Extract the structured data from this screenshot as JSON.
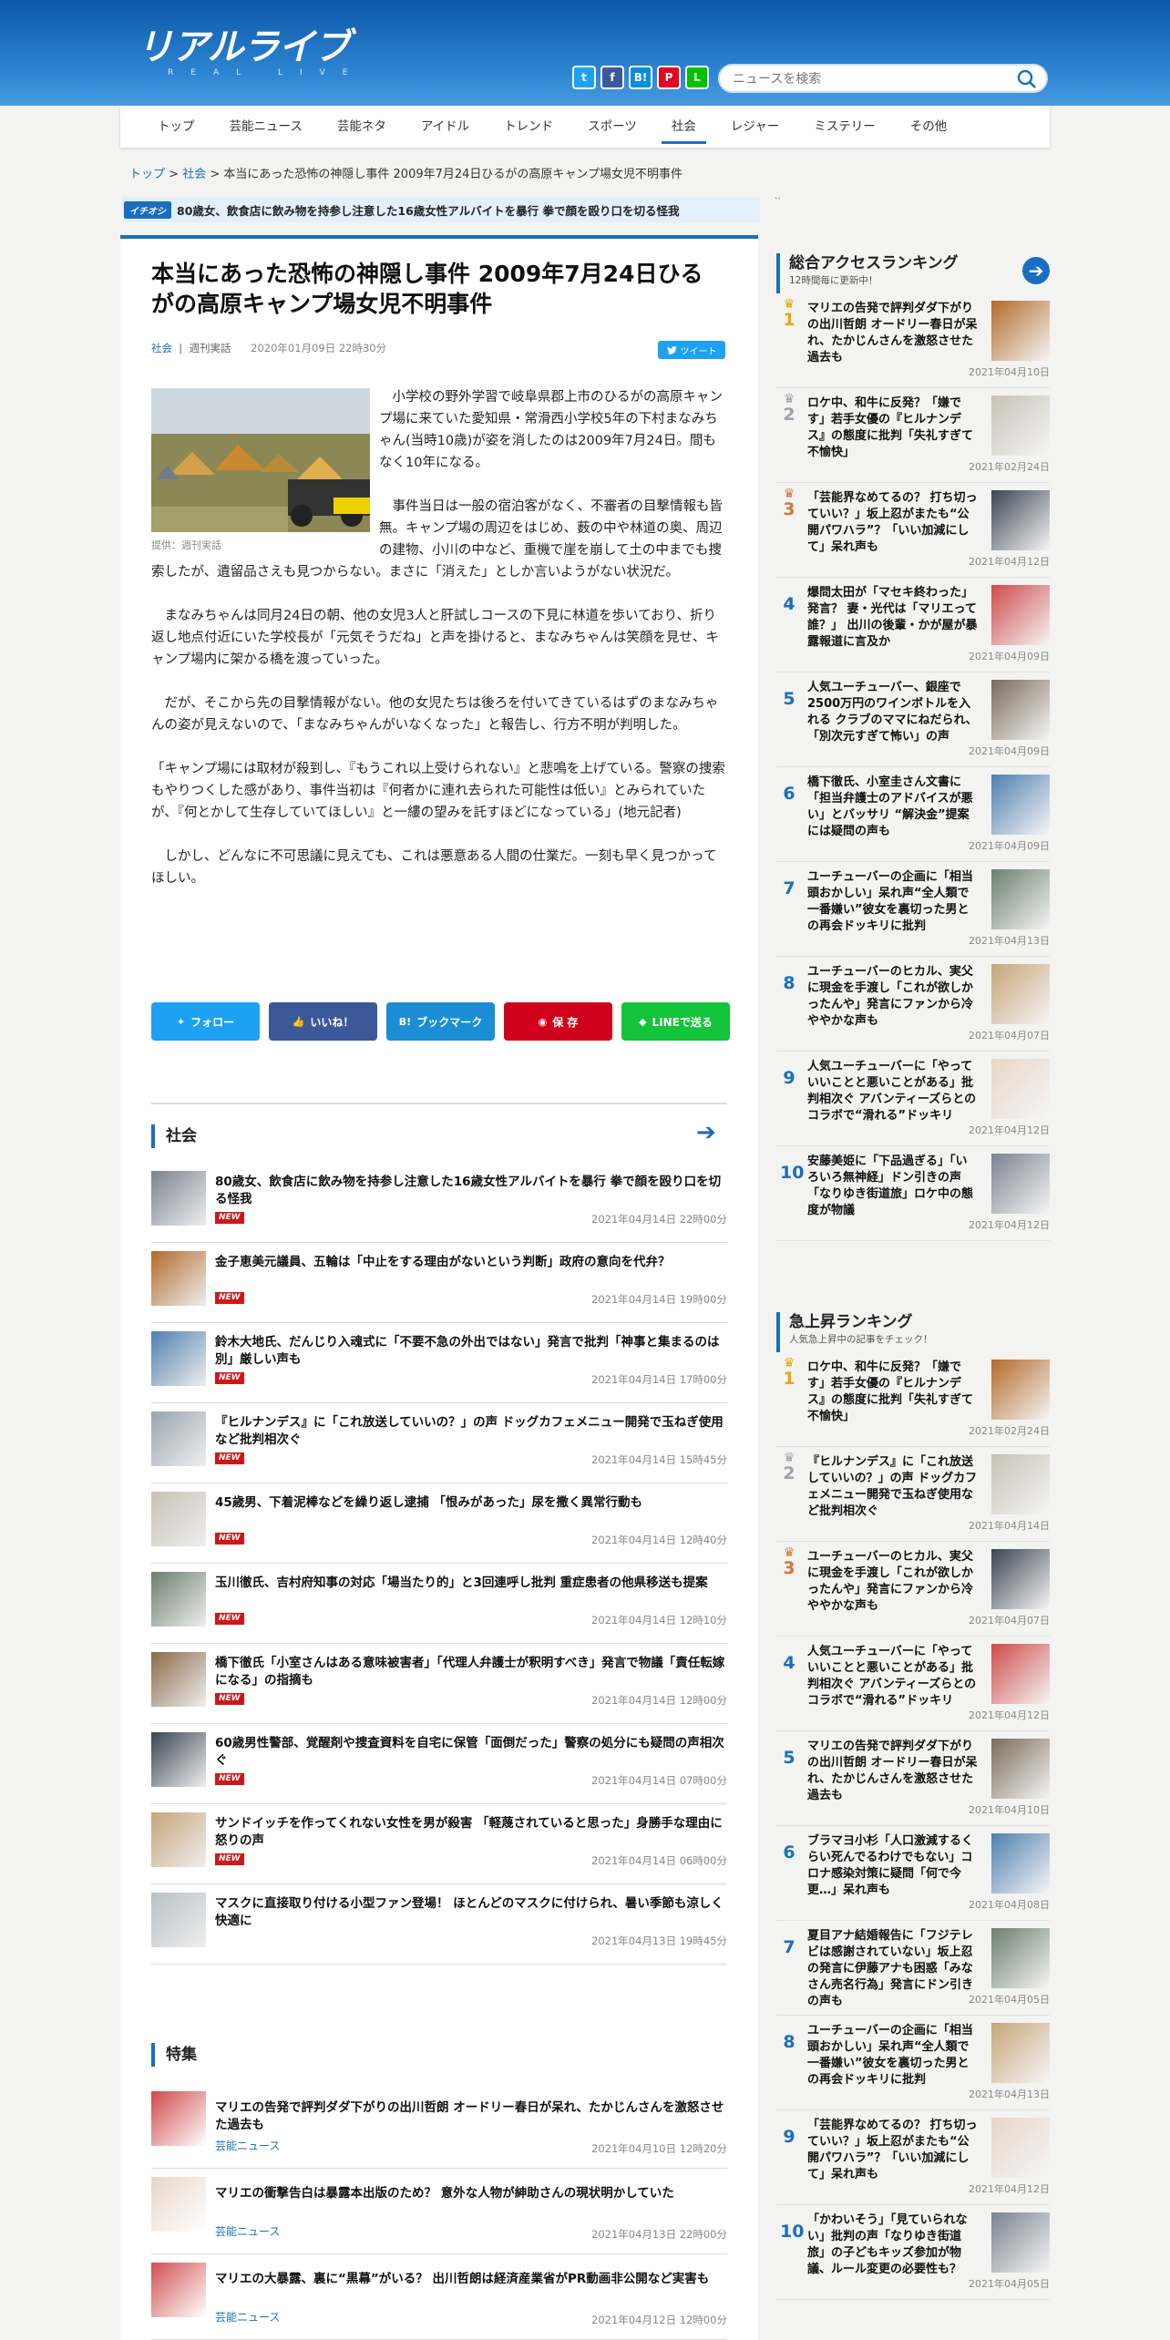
{
  "site": {
    "logo_text": "リアルライブ",
    "logo_sub": "REAL LIVE"
  },
  "search": {
    "placeholder": "ニュースを検索"
  },
  "share_icons": [
    {
      "label": "t",
      "color": "#1da1f2"
    },
    {
      "label": "f",
      "color": "#3b5998"
    },
    {
      "label": "B!",
      "color": "#008fde"
    },
    {
      "label": "P",
      "color": "#e60023"
    },
    {
      "label": "L",
      "color": "#00c300"
    }
  ],
  "nav": [
    "トップ",
    "芸能ニュース",
    "芸能ネタ",
    "アイドル",
    "トレンド",
    "スポーツ",
    "社会",
    "レジャー",
    "ミステリー",
    "その他"
  ],
  "nav_active": "社会",
  "breadcrumb": {
    "home": "トップ",
    "cat": "社会",
    "sep": ">",
    "current": "本当にあった恐怖の神隠し事件 2009年7月24日ひるがの高原キャンプ場女児不明事件"
  },
  "ticker": {
    "tag": "イチオシ",
    "text": "80歳女、飲食店に飲み物を持参し注意した16歳女性アルバイトを暴行 拳で顔を殴り口を切る怪我"
  },
  "side_fragment": "‥",
  "article": {
    "title": "本当にあった恐怖の神隠し事件 2009年7月24日ひるがの高原キャンプ場女児不明事件",
    "category": "社会",
    "source": "週刊実話",
    "date": "2020年01月09日 22時30分",
    "tweet": "ツイート",
    "caption": "提供：週刊実話",
    "paragraphs": [
      "小学校の野外学習で岐阜県郡上市のひるがの高原キャンプ場に来ていた愛知県・常滑西小学校5年の下村まなみちゃん(当時10歳)が姿を消したのは2009年7月24日。間もなく10年になる。",
      "事件当日は一般の宿泊客がなく、不審者の目撃情報も皆無。キャンプ場の周辺をはじめ、薮の中や林道の奥、周辺の建物、小川の中など、重機で崖を崩して土の中までも捜索したが、遺留品さえも見つからない。まさに「消えた」としか言いようがない状況だ。",
      "まなみちゃんは同月24日の朝、他の女児3人と肝試しコースの下見に林道を歩いており、折り返し地点付近にいた学校長が「元気そうだね」と声を掛けると、まなみちゃんは笑顔を見せ、キャンプ場内に架かる橋を渡っていった。",
      "だが、そこから先の目撃情報がない。他の女児たちは後ろを付いてきているはずのまなみちゃんの姿が見えないので、「まなみちゃんがいなくなった」と報告し、行方不明が判明した。",
      "「キャンプ場には取材が殺到し、『もうこれ以上受けられない』と悲鳴を上げている。警察の捜索もやりつくした感があり、事件当初は『何者かに連れ去られた可能性は低い』とみられていたが、『何とかして生存していてほしい』と一縷の望みを託すほどになっている」(地元記者)",
      "しかし、どんなに不可思議に見えても、これは悪意ある人間の仕業だ。一刻も早く見つかってほしい。"
    ]
  },
  "share_bar": [
    {
      "label": "フォロー",
      "color": "#1da1f2"
    },
    {
      "label": "いいね！",
      "color": "#3b5998"
    },
    {
      "label": "ブックマーク",
      "color": "#1b8ed6"
    },
    {
      "label": "保 存",
      "color": "#d0021b"
    },
    {
      "label": "LINEで送る",
      "color": "#14c43a"
    }
  ],
  "social_section": {
    "title": "社会",
    "new_label": "NEW",
    "items": [
      {
        "title": "80歳女、飲食店に飲み物を持参し注意した16歳女性アルバイトを暴行 拳で顔を殴り口を切る怪我",
        "date": "2021年04月14日 22時00分"
      },
      {
        "title": "金子恵美元議員、五輪は「中止をする理由がないという判断」政府の意向を代弁？",
        "date": "2021年04月14日 19時00分"
      },
      {
        "title": "鈴木大地氏、だんじり入魂式に「不要不急の外出ではない」発言で批判「神事と集まるのは別」厳しい声も",
        "date": "2021年04月14日 17時00分"
      },
      {
        "title": "『ヒルナンデス』に「これ放送していいの？」の声 ドッグカフェメニュー開発で玉ねぎ使用など批判相次ぐ",
        "date": "2021年04月14日 15時45分"
      },
      {
        "title": "45歳男、下着泥棒などを繰り返し逮捕 「恨みがあった」尿を撒く異常行動も",
        "date": "2021年04月14日 12時40分"
      },
      {
        "title": "玉川徹氏、吉村府知事の対応「場当たり的」と3回連呼し批判 重症患者の他県移送も提案",
        "date": "2021年04月14日 12時10分"
      },
      {
        "title": "橋下徹氏「小室さんはある意味被害者」「代理人弁護士が釈明すべき」発言で物議「責任転嫁になる」の指摘も",
        "date": "2021年04月14日 12時00分"
      },
      {
        "title": "60歳男性警部、覚醒剤や捜査資料を自宅に保管「面倒だった」警察の処分にも疑問の声相次ぐ",
        "date": "2021年04月14日 07時00分"
      },
      {
        "title": "サンドイッチを作ってくれない女性を男が殺害 「軽蔑されていると思った」身勝手な理由に怒りの声",
        "date": "2021年04月14日 06時00分"
      },
      {
        "title": "マスクに直接取り付ける小型ファン登場！ ほとんどのマスクに付けられ、暑い季節も涼しく快適に",
        "date": "2021年04月13日 19時45分"
      }
    ]
  },
  "feature_section": {
    "title": "特集",
    "items": [
      {
        "title": "マリエの告発で評判ダダ下がりの出川哲朗 オードリー春日が呆れ、たかじんさんを激怒させた過去も",
        "cat": "芸能ニュース",
        "date": "2021年04月10日 12時20分"
      },
      {
        "title": "マリエの衝撃告白は暴露本出版のため？ 意外な人物が紳助さんの現状明かしていた",
        "cat": "芸能ニュース",
        "date": "2021年04月13日 22時00分"
      },
      {
        "title": "マリエの大暴露、裏に“黒幕”がいる？ 出川哲朗は経済産業省がPR動画非公開など実害も",
        "cat": "芸能ニュース",
        "date": "2021年04月12日 12時00分"
      }
    ]
  },
  "access_ranking": {
    "title": "総合アクセスランキング",
    "sub": "12時間毎に更新中！",
    "items": [
      {
        "rank": "1",
        "title": "マリエの告発で評判ダダ下がりの出川哲朗 オードリー春日が呆れ、たかじんさんを激怒させた過去も",
        "date": "2021年04月10日"
      },
      {
        "rank": "2",
        "title": "ロケ中、和牛に反発？「嫌です」若手女優の『ヒルナンデス』の態度に批判「失礼すぎて不愉快」",
        "date": "2021年02月24日"
      },
      {
        "rank": "3",
        "title": "「芸能界なめてるの？ 打ち切っていい？」坂上忍がまたも“公開パワハラ”？「いい加減にして」呆れ声も",
        "date": "2021年04月12日"
      },
      {
        "rank": "4",
        "title": "爆問太田が「マセキ終わった」発言？ 妻・光代は「マリエって誰？」 出川の後輩・かが屋が暴露報道に言及か",
        "date": "2021年04月09日"
      },
      {
        "rank": "5",
        "title": "人気ユーチューバー、銀座で2500万円のワインボトルを入れる クラブのママにねだられ、「別次元すぎて怖い」の声",
        "date": "2021年04月09日"
      },
      {
        "rank": "6",
        "title": "橋下徹氏、小室圭さん文書に「担当弁護士のアドバイスが悪い」とバッサリ “解決金”提案には疑問の声も",
        "date": "2021年04月09日"
      },
      {
        "rank": "7",
        "title": "ユーチューバーの企画に「相当頭おかしい」呆れ声“全人類で一番嫌い”彼女を裏切った男との再会ドッキリに批判",
        "date": "2021年04月13日"
      },
      {
        "rank": "8",
        "title": "ユーチューバーのヒカル、実父に現金を手渡し「これが欲しかったんや」発言にファンから冷ややかな声も",
        "date": "2021年04月07日"
      },
      {
        "rank": "9",
        "title": "人気ユーチューバーに「やっていいことと悪いことがある」批判相次ぐ アバンティーズらとのコラボで“滑れる”ドッキリ",
        "date": "2021年04月12日"
      },
      {
        "rank": "10",
        "title": "安藤美姫に「下品過ぎる」「いろいろ無神経」ドン引きの声「なりゆき街道旅」ロケ中の態度が物議",
        "date": "2021年04月12日"
      }
    ]
  },
  "rising_ranking": {
    "title": "急上昇ランキング",
    "sub": "人気急上昇中の記事をチェック！",
    "items": [
      {
        "rank": "1",
        "title": "ロケ中、和牛に反発？「嫌です」若手女優の『ヒルナンデス』の態度に批判「失礼すぎて不愉快」",
        "date": "2021年02月24日"
      },
      {
        "rank": "2",
        "title": "『ヒルナンデス』に「これ放送していいの？」の声 ドッグカフェメニュー開発で玉ねぎ使用など批判相次ぐ",
        "date": "2021年04月14日"
      },
      {
        "rank": "3",
        "title": "ユーチューバーのヒカル、実父に現金を手渡し「これが欲しかったんや」発言にファンから冷ややかな声も",
        "date": "2021年04月07日"
      },
      {
        "rank": "4",
        "title": "人気ユーチューバーに「やっていいことと悪いことがある」批判相次ぐ アバンティーズらとのコラボで“滑れる”ドッキリ",
        "date": "2021年04月12日"
      },
      {
        "rank": "5",
        "title": "マリエの告発で評判ダダ下がりの出川哲朗 オードリー春日が呆れ、たかじんさんを激怒させた過去も",
        "date": "2021年04月10日"
      },
      {
        "rank": "6",
        "title": "ブラマヨ小杉「人口激減するくらい死んでるわけでもない」コロナ感染対策に疑問「何で今更…」呆れ声も",
        "date": "2021年04月08日"
      },
      {
        "rank": "7",
        "title": "夏目アナ結婚報告に「フジテレビは感謝されていない」坂上忍の発言に伊藤アナも困惑「みなさん売名行為」発言にドン引きの声も",
        "date": "2021年04月05日"
      },
      {
        "rank": "8",
        "title": "ユーチューバーの企画に「相当頭おかしい」呆れ声“全人類で一番嫌い”彼女を裏切った男との再会ドッキリに批判",
        "date": "2021年04月13日"
      },
      {
        "rank": "9",
        "title": "「芸能界なめてるの？ 打ち切っていい？」坂上忍がまたも“公開パワハラ”？「いい加減にして」呆れ声も",
        "date": "2021年04月12日"
      },
      {
        "rank": "10",
        "title": "「かわいそう」「見ていられない」批判の声「なりゆき街道旅」の子どもキッズ参加が物議、ルール変更の必要性も？",
        "date": "2021年04月05日"
      }
    ]
  },
  "colors": {
    "brand": "#1a6ec0",
    "new_badge": "#d01717",
    "gold": "#e6a800",
    "silver": "#9aa3ad",
    "bronze": "#d4763b"
  }
}
